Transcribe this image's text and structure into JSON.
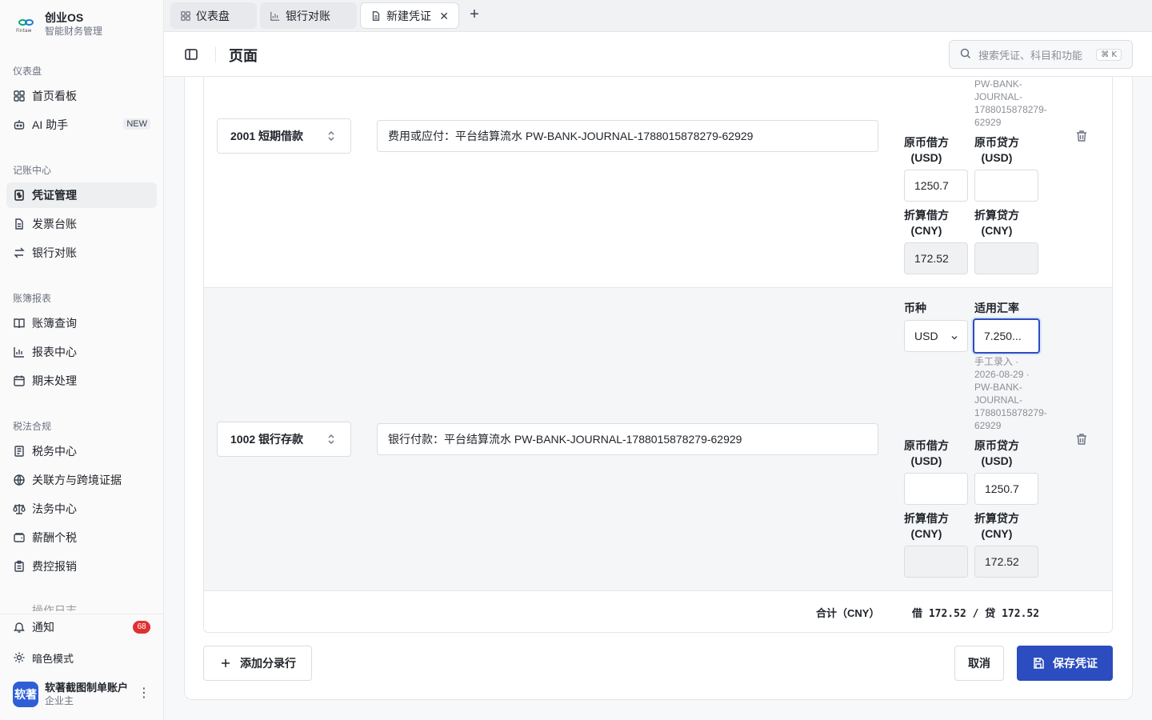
{
  "brand": {
    "title": "创业OS",
    "subtitle": "智能财务管理",
    "logo_text": "Fintaw"
  },
  "sidebar": {
    "sections": [
      {
        "label": "仪表盘"
      },
      {
        "label": "记账中心"
      },
      {
        "label": "账簿报表"
      },
      {
        "label": "税法合规"
      }
    ],
    "items": [
      {
        "label": "首页看板",
        "icon": "grid-icon"
      },
      {
        "label": "AI 助手",
        "icon": "bot-icon",
        "badge": "NEW"
      },
      {
        "label": "凭证管理",
        "icon": "voucher-icon"
      },
      {
        "label": "发票台账",
        "icon": "invoice-icon"
      },
      {
        "label": "银行对账",
        "icon": "swap-icon"
      },
      {
        "label": "账簿查询",
        "icon": "book-icon"
      },
      {
        "label": "报表中心",
        "icon": "bar-chart-icon"
      },
      {
        "label": "期末处理",
        "icon": "calendar-icon"
      },
      {
        "label": "税务中心",
        "icon": "tax-doc-icon"
      },
      {
        "label": "关联方与跨境证据",
        "icon": "globe-icon"
      },
      {
        "label": "法务中心",
        "icon": "scale-icon"
      },
      {
        "label": "薪酬个税",
        "icon": "wallet-icon"
      },
      {
        "label": "费控报销",
        "icon": "clipboard-icon"
      }
    ],
    "partial_item": "操作日志",
    "notifications": {
      "label": "通知",
      "count": "68"
    },
    "dark_mode": "暗色模式",
    "user": {
      "avatar": "软著",
      "name": "软著截图制单账户",
      "role": "企业主"
    }
  },
  "tabs": [
    {
      "label": "仪表盘"
    },
    {
      "label": "银行对账"
    },
    {
      "label": "新建凭证"
    }
  ],
  "header": {
    "title": "页面",
    "search_placeholder": "搜索凭证、科目和功能",
    "shortcut": "⌘ K"
  },
  "entries": [
    {
      "account": "2001 短期借款",
      "description": "费用或应付：平台结算流水 PW-BANK-JOURNAL-1788015878279-62929",
      "rate_note_top": [
        "PW-BANK-",
        "JOURNAL-",
        "1788015878279-",
        "62929"
      ],
      "orig_debit_label": [
        "原币借方",
        "(USD)"
      ],
      "orig_credit_label": [
        "原币贷方",
        "(USD)"
      ],
      "orig_debit": "1250.7",
      "orig_credit": "",
      "cny_debit_label": [
        "折算借方",
        "(CNY)"
      ],
      "cny_credit_label": [
        "折算贷方",
        "(CNY)"
      ],
      "cny_debit": "172.52",
      "cny_credit": ""
    },
    {
      "account": "1002 银行存款",
      "description": "银行付款：平台结算流水 PW-BANK-JOURNAL-1788015878279-62929",
      "currency_label": "币种",
      "currency": "USD",
      "rate_label": "适用汇率",
      "rate": "7.250...",
      "rate_note": [
        "手工录入 ·",
        "2026-08-29 ·",
        "PW-BANK-",
        "JOURNAL-",
        "1788015878279-",
        "62929"
      ],
      "orig_debit_label": [
        "原币借方",
        "(USD)"
      ],
      "orig_credit_label": [
        "原币贷方",
        "(USD)"
      ],
      "orig_debit": "",
      "orig_credit": "1250.7",
      "cny_debit_label": [
        "折算借方",
        "(CNY)"
      ],
      "cny_credit_label": [
        "折算贷方",
        "(CNY)"
      ],
      "cny_debit": "",
      "cny_credit": "172.52"
    }
  ],
  "totals": {
    "label": "合计（CNY）",
    "value": "借 172.52 / 贷 172.52"
  },
  "actions": {
    "add_row": "添加分录行",
    "cancel": "取消",
    "save": "保存凭证"
  },
  "colors": {
    "primary": "#2b4dbf",
    "badge_red": "#e03131",
    "active_nav": "#eeeff1"
  }
}
